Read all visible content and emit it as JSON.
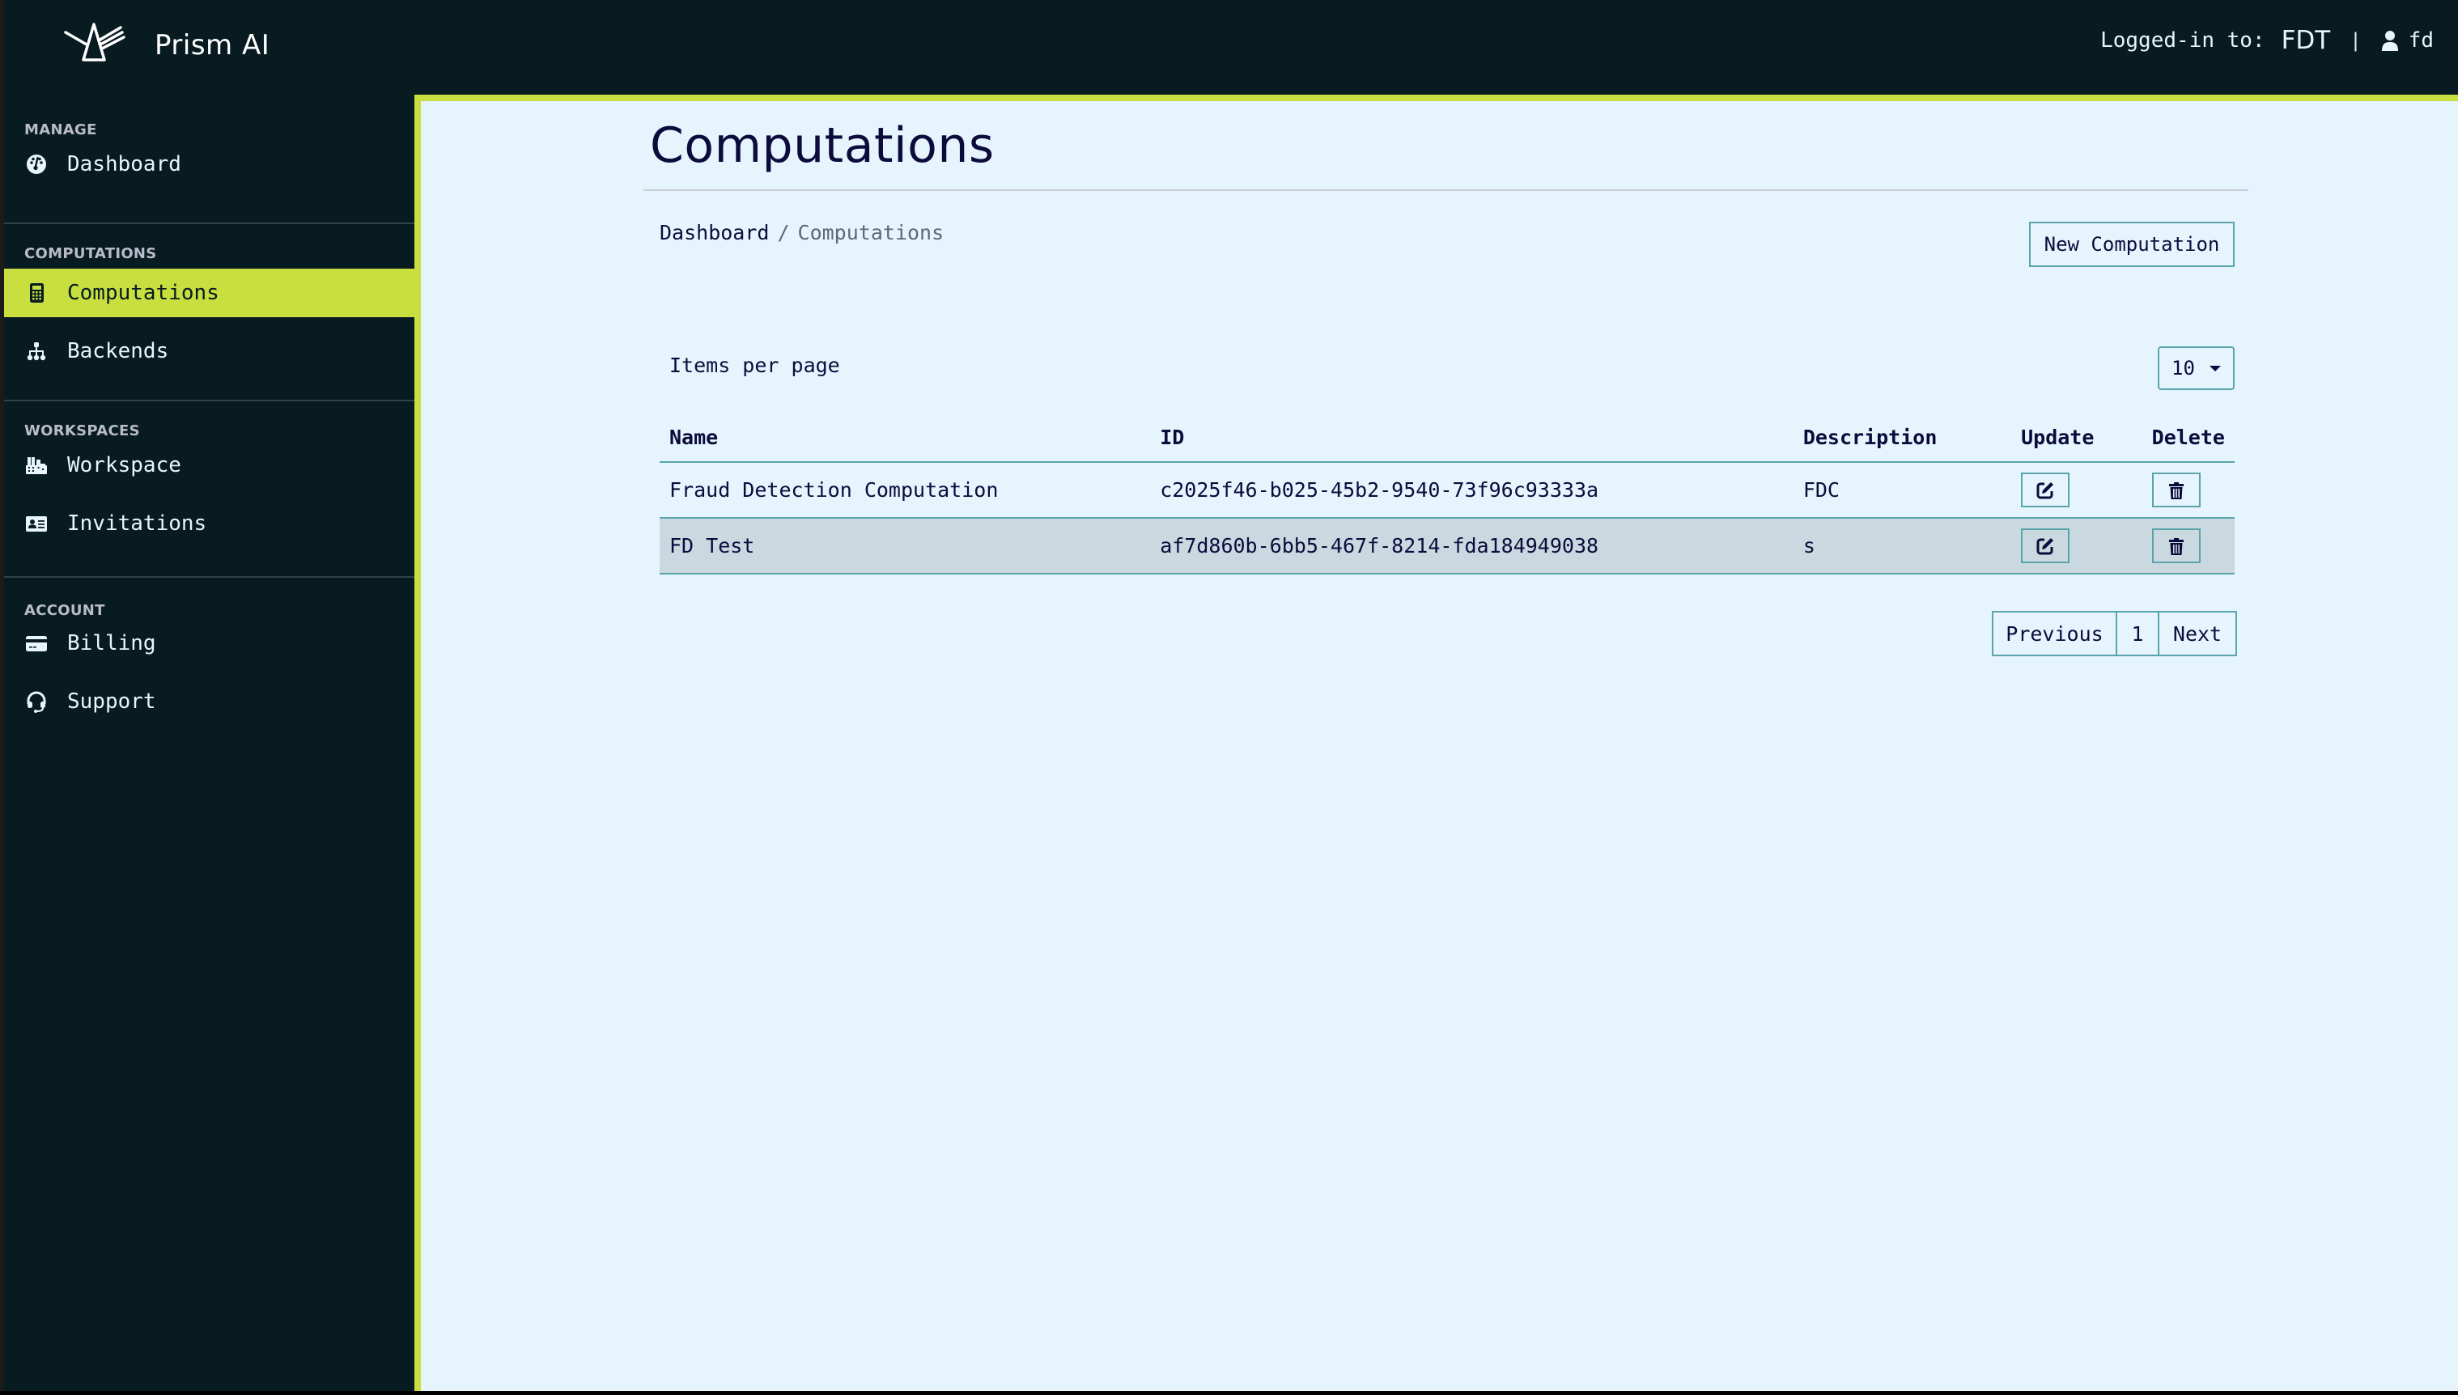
{
  "app": {
    "brand": "Prism AI",
    "logo_icon": "prism-logo-icon"
  },
  "header": {
    "logged_in_label": "Logged-in to:",
    "tenant": "FDT",
    "separator": "|",
    "user_icon": "user-icon",
    "username": "fd"
  },
  "sidebar": {
    "sections": [
      {
        "title": "MANAGE",
        "items": [
          {
            "label": "Dashboard",
            "icon": "tachometer-icon",
            "active": false
          }
        ]
      },
      {
        "title": "COMPUTATIONS",
        "items": [
          {
            "label": "Computations",
            "icon": "calculator-icon",
            "active": true
          },
          {
            "label": "Backends",
            "icon": "sitemap-icon",
            "active": false
          }
        ]
      },
      {
        "title": "WORKSPACES",
        "items": [
          {
            "label": "Workspace",
            "icon": "building-icon",
            "active": false
          },
          {
            "label": "Invitations",
            "icon": "id-card-icon",
            "active": false
          }
        ]
      },
      {
        "title": "ACCOUNT",
        "items": [
          {
            "label": "Billing",
            "icon": "credit-card-icon",
            "active": false
          },
          {
            "label": "Support",
            "icon": "headset-icon",
            "active": false
          }
        ]
      }
    ]
  },
  "page": {
    "title": "Computations",
    "breadcrumb": {
      "parent": "Dashboard",
      "separator": "/",
      "current": "Computations"
    },
    "new_button": "New Computation",
    "items_per_page_label": "Items per page",
    "items_per_page_value": "10"
  },
  "table": {
    "columns": [
      "Name",
      "ID",
      "Description",
      "Update",
      "Delete"
    ],
    "rows": [
      {
        "name": "Fraud Detection Computation",
        "id": "c2025f46-b025-45b2-9540-73f96c93333a",
        "description": "FDC"
      },
      {
        "name": "FD Test",
        "id": "af7d860b-6bb5-467f-8214-fda184949038",
        "description": "s"
      }
    ],
    "update_icon": "edit-icon",
    "delete_icon": "trash-icon"
  },
  "pagination": {
    "previous": "Previous",
    "current_page": "1",
    "next": "Next"
  },
  "colors": {
    "sidebar_bg": "#081b21",
    "accent": "#c8df3f",
    "content_bg": "#e6f4fd",
    "text_dark": "#0c0c3c",
    "border_teal": "#5aa5ac",
    "row_alt": "#cad8e0"
  }
}
